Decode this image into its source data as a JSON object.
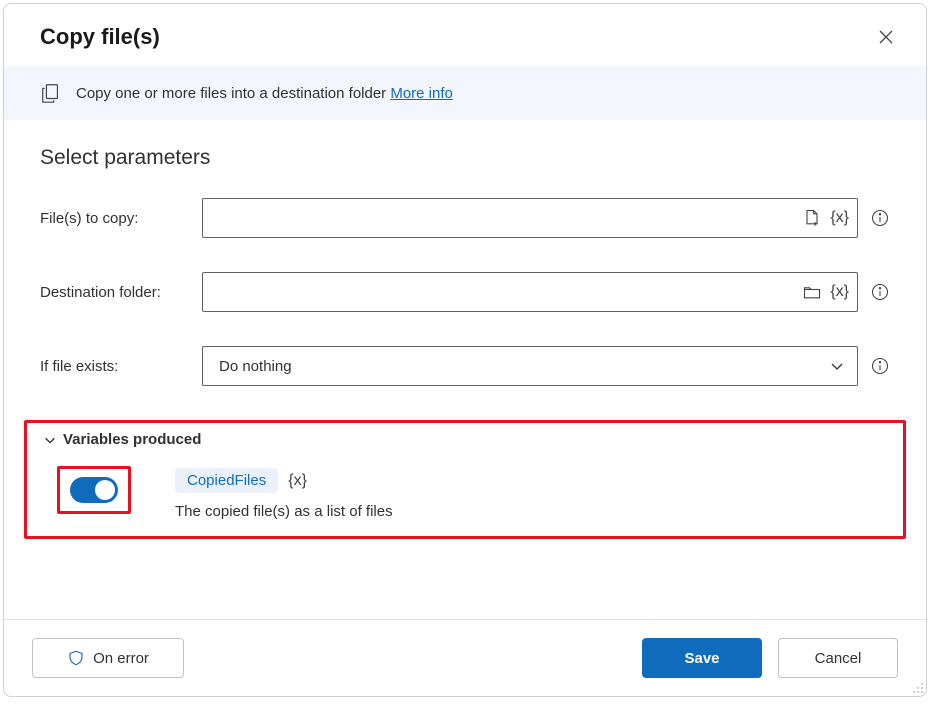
{
  "header": {
    "title": "Copy file(s)"
  },
  "banner": {
    "text": "Copy one or more files into a destination folder ",
    "link_text": "More info"
  },
  "section": {
    "heading": "Select parameters"
  },
  "fields": {
    "files_to_copy_label": "File(s) to copy:",
    "destination_label": "Destination folder:",
    "if_exists_label": "If file exists:",
    "if_exists_value": "Do nothing"
  },
  "variables": {
    "header": "Variables produced",
    "name": "CopiedFiles",
    "x_label": "{x}",
    "description": "The copied file(s) as a list of files"
  },
  "footer": {
    "on_error": "On error",
    "save": "Save",
    "cancel": "Cancel"
  }
}
